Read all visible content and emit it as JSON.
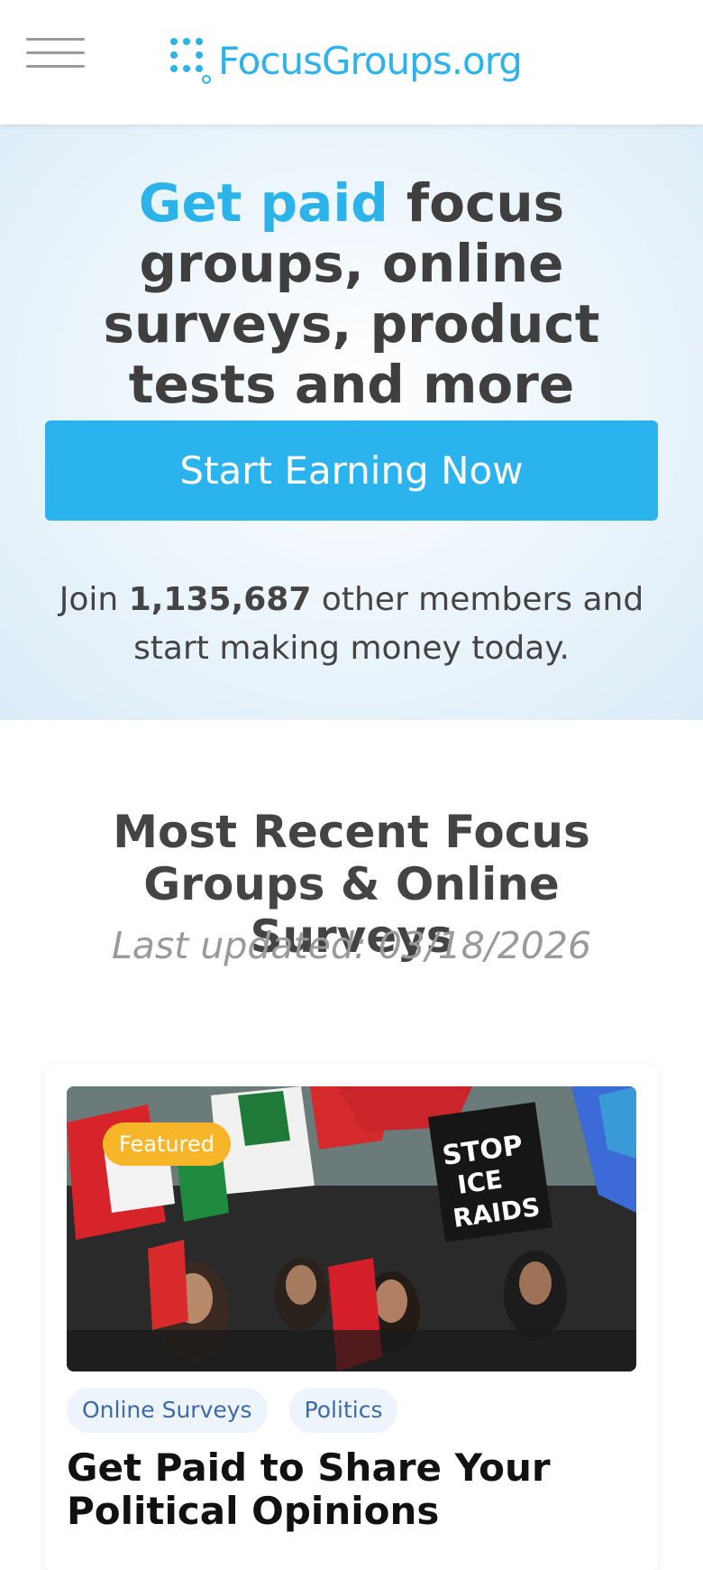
{
  "header": {
    "logo_text": "FocusGroups.org",
    "brand_color": "#2bb3ea",
    "menu_icon": "hamburger-menu-icon"
  },
  "hero": {
    "title_accent": "Get paid",
    "title_rest": " focus groups, online surveys, product tests and more",
    "cta_label": "Start Earning Now",
    "join_prefix": "Join ",
    "member_count": "1,135,687",
    "join_suffix": " other members and start making money today."
  },
  "listing": {
    "title": "Most Recent Focus Groups & Online Surveys",
    "last_updated": "Last updated: 03/18/2026"
  },
  "card": {
    "badge": "Featured",
    "tags": [
      "Online Surveys",
      "Politics"
    ],
    "title": "Get Paid to Share Your Political Opinions",
    "image_sign_text": "STOP ICE RAIDS"
  }
}
